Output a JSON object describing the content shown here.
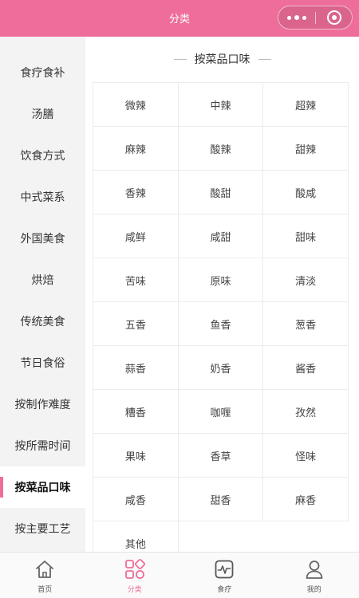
{
  "header": {
    "title": "分类",
    "more_icon": "more-dots-icon",
    "close_icon": "close-circle-icon"
  },
  "sidebar": {
    "items": [
      {
        "label": "食疗食补"
      },
      {
        "label": "汤膳"
      },
      {
        "label": "饮食方式"
      },
      {
        "label": "中式菜系"
      },
      {
        "label": "外国美食"
      },
      {
        "label": "烘焙"
      },
      {
        "label": "传统美食"
      },
      {
        "label": "节日食俗"
      },
      {
        "label": "按制作难度"
      },
      {
        "label": "按所需时间"
      },
      {
        "label": "按菜品口味"
      },
      {
        "label": "按主要工艺"
      }
    ],
    "active_index": 10
  },
  "content": {
    "section_title": "按菜品口味",
    "tastes": [
      "微辣",
      "中辣",
      "超辣",
      "麻辣",
      "酸辣",
      "甜辣",
      "香辣",
      "酸甜",
      "酸咸",
      "咸鲜",
      "咸甜",
      "甜味",
      "苦味",
      "原味",
      "清淡",
      "五香",
      "鱼香",
      "葱香",
      "蒜香",
      "奶香",
      "酱香",
      "糟香",
      "咖喱",
      "孜然",
      "果味",
      "香草",
      "怪味",
      "咸香",
      "甜香",
      "麻香",
      "其他"
    ]
  },
  "tabbar": {
    "tabs": [
      {
        "label": "首页",
        "icon": "home-icon"
      },
      {
        "label": "分类",
        "icon": "category-icon"
      },
      {
        "label": "食疗",
        "icon": "health-monitor-icon"
      },
      {
        "label": "我的",
        "icon": "user-icon"
      }
    ],
    "active_index": 1
  },
  "colors": {
    "brand": "#ee6d9a",
    "sidebar_bg": "#f3f3f3",
    "grid_line": "#ececec"
  }
}
